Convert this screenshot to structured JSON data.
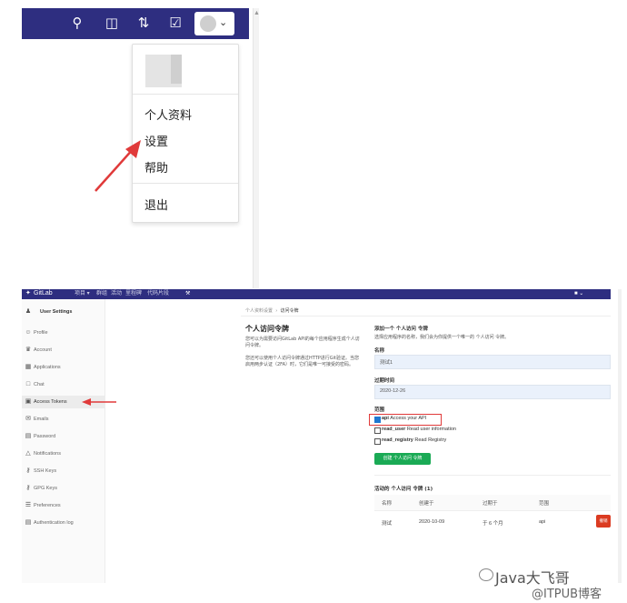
{
  "top": {
    "menu_items": [
      "个人资料",
      "设置",
      "帮助",
      "退出"
    ]
  },
  "bottom": {
    "nav": {
      "brand": "GitLab",
      "items": [
        "项目 ▾",
        "群组",
        "活动",
        "里程碑",
        "代码片段"
      ]
    },
    "sidebar": {
      "header": "User Settings",
      "items": [
        {
          "label": "Profile",
          "icon": "profile-icon"
        },
        {
          "label": "Account",
          "icon": "account-icon"
        },
        {
          "label": "Applications",
          "icon": "applications-icon"
        },
        {
          "label": "Chat",
          "icon": "chat-icon"
        },
        {
          "label": "Access Tokens",
          "icon": "access-tokens-icon"
        },
        {
          "label": "Emails",
          "icon": "emails-icon"
        },
        {
          "label": "Password",
          "icon": "password-icon"
        },
        {
          "label": "Notifications",
          "icon": "notifications-icon"
        },
        {
          "label": "SSH Keys",
          "icon": "ssh-keys-icon"
        },
        {
          "label": "GPG Keys",
          "icon": "gpg-keys-icon"
        },
        {
          "label": "Preferences",
          "icon": "preferences-icon"
        },
        {
          "label": "Authentication log",
          "icon": "authentication-log-icon"
        }
      ]
    },
    "breadcrumb": [
      "个人资料设置",
      "访问令牌"
    ],
    "left_panel": {
      "title": "个人访问令牌",
      "desc1": "您可以为需要访问GitLab API的每个应用程序生成个人访问令牌。",
      "desc2": "您还可以使用个人访问令牌通过HTTP进行Git验证。当您启用两步认证（2FA）时，它们是唯一可接受的密码。"
    },
    "form": {
      "heading": "添加一个 个人访问 令牌",
      "desc": "选择应用程序的名称，我们会为你提供一个唯一的 个人访问 令牌。",
      "name_label": "名称",
      "name_value": "测试1",
      "expiry_label": "过期时间",
      "expiry_value": "2020-12-26",
      "scopes_label": "范围",
      "scopes": [
        {
          "name": "api",
          "desc": "Access your API",
          "checked": true
        },
        {
          "name": "read_user",
          "desc": "Read user information",
          "checked": false
        },
        {
          "name": "read_registry",
          "desc": "Read Registry",
          "checked": false
        }
      ],
      "create_button": "创建 个人访问 令牌"
    },
    "active": {
      "heading": "活动的 个人访问 令牌 (1)",
      "headers": [
        "名称",
        "创建于",
        "过期于",
        "范围"
      ],
      "rows": [
        {
          "name": "测试",
          "created": "2020-10-09",
          "expires": "于 6 个月",
          "scope": "api",
          "action": "撤销"
        }
      ]
    }
  },
  "watermark": {
    "line1": "Java大飞哥",
    "line2": "@ITPUB博客"
  }
}
